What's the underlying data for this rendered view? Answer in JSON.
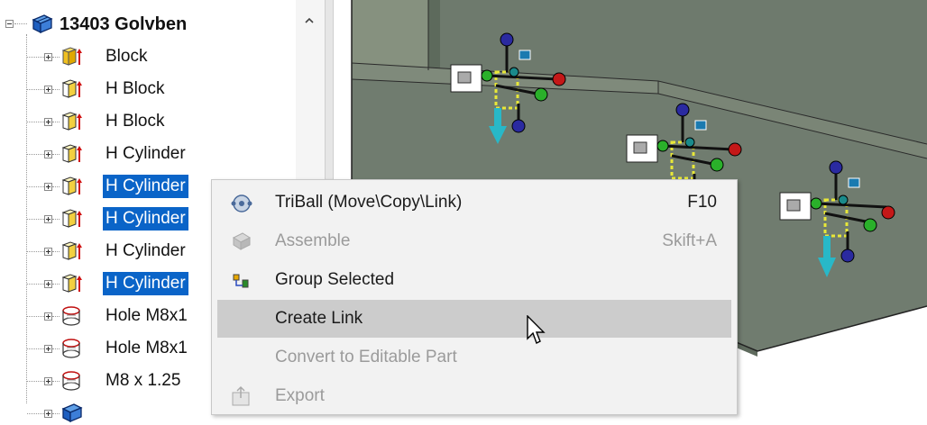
{
  "tree": {
    "root": {
      "label": "13403 Golvben",
      "icon": "assembly-icon"
    },
    "items": [
      {
        "label": "Block",
        "icon": "solid-block-icon",
        "selected": false
      },
      {
        "label": "H Block",
        "icon": "hollow-block-icon",
        "selected": false
      },
      {
        "label": "H Block",
        "icon": "hollow-block-icon",
        "selected": false
      },
      {
        "label": "H Cylinder",
        "icon": "hollow-block-icon",
        "selected": false
      },
      {
        "label": "H Cylinder",
        "icon": "hollow-block-icon",
        "selected": true
      },
      {
        "label": "H Cylinder",
        "icon": "hollow-block-icon",
        "selected": true
      },
      {
        "label": "H Cylinder",
        "icon": "hollow-block-icon",
        "selected": false
      },
      {
        "label": "H Cylinder",
        "icon": "hollow-block-icon",
        "selected": true
      },
      {
        "label": "Hole M8x1",
        "icon": "hole-icon",
        "selected": false
      },
      {
        "label": "Hole M8x1",
        "icon": "hole-icon",
        "selected": false
      },
      {
        "label": "M8 x 1.25",
        "icon": "hole-icon",
        "selected": false
      },
      {
        "label": "",
        "icon": "assembly-icon",
        "selected": false
      }
    ]
  },
  "context_menu": {
    "items": [
      {
        "label": "TriBall (Move\\Copy\\Link)",
        "shortcut": "F10",
        "icon": "triball-icon",
        "disabled": false,
        "hover": false
      },
      {
        "label": "Assemble",
        "shortcut": "Skift+A",
        "icon": "assemble-icon",
        "disabled": true,
        "hover": false
      },
      {
        "label": "Group Selected",
        "shortcut": "",
        "icon": "group-icon",
        "disabled": false,
        "hover": false
      },
      {
        "label": "Create Link",
        "shortcut": "",
        "icon": "",
        "disabled": false,
        "hover": true
      },
      {
        "label": "Convert to Editable Part",
        "shortcut": "",
        "icon": "",
        "disabled": true,
        "hover": false
      },
      {
        "label": "Export",
        "shortcut": "",
        "icon": "export-icon",
        "disabled": true,
        "hover": false
      }
    ]
  },
  "colors": {
    "selection": "#0a64c8",
    "menu_bg": "#f2f2f2",
    "menu_hover": "#cccccc",
    "model_face": "#6f7a6e",
    "model_top": "#7d887b",
    "triball_yellow": "#e8e838",
    "axis_cyan": "#28b8c8"
  }
}
